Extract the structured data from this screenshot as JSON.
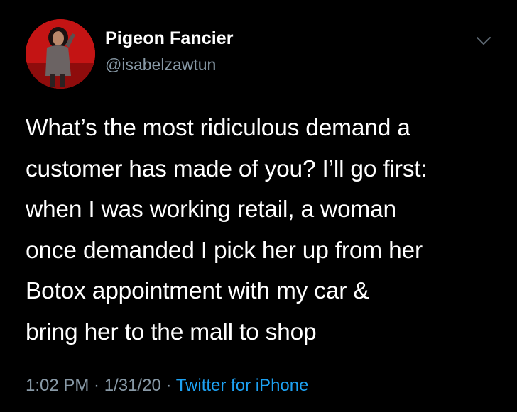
{
  "tweet": {
    "display_name": "Pigeon Fancier",
    "handle": "@isabelzawtun",
    "text": "What’s the most ridiculous demand a\ncustomer has made of you? I’ll go first:\nwhen I was working retail, a woman\nonce demanded I pick her up from her\nBotox appointment with my car &\nbring her to the mall to shop",
    "time": "1:02 PM",
    "separator": " · ",
    "date": "1/31/20",
    "source": "Twitter for iPhone"
  },
  "icons": {
    "menu": "chevron-down-icon",
    "avatar": "profile-photo"
  },
  "colors": {
    "background": "#000000",
    "primary_text": "#ffffff",
    "secondary_text": "#8899a6",
    "link": "#1da1f2",
    "avatar_bg": "#c41414"
  }
}
